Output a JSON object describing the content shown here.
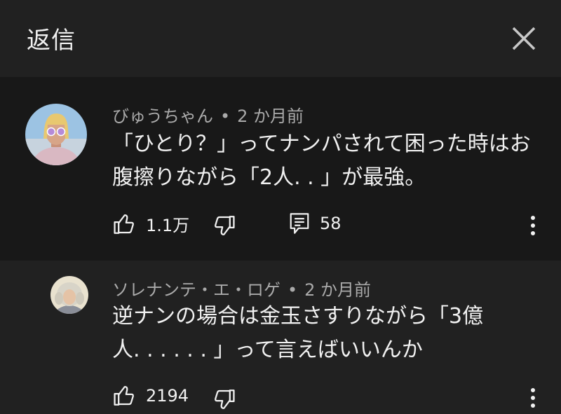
{
  "header": {
    "title": "返信",
    "close_icon": "close-icon"
  },
  "comments": [
    {
      "author": "びゅうちゃん",
      "separator": "•",
      "time": "2 か月前",
      "text": "「ひとり？」ってナンパされて困った時はお\n腹擦りながら「2人. . 」が最強。",
      "likes": "1.1万",
      "replies": "58",
      "icons": [
        "thumbs-up-icon",
        "thumbs-down-icon",
        "reply-icon",
        "more-vert-icon"
      ]
    },
    {
      "author": "ソレナンテ・エ・ロゲ",
      "separator": "•",
      "time": "2 か月前",
      "text": "逆ナンの場合は金玉さすりながら「3億\n人. . . . . . 」って言えばいいんか",
      "likes": "2194",
      "icons": [
        "thumbs-up-icon",
        "thumbs-down-icon",
        "more-vert-icon"
      ]
    }
  ],
  "colors": {
    "background": "#212121",
    "highlight_background": "#181818",
    "primary_text": "#f1f1f1",
    "secondary_text": "#aaaaaa"
  }
}
